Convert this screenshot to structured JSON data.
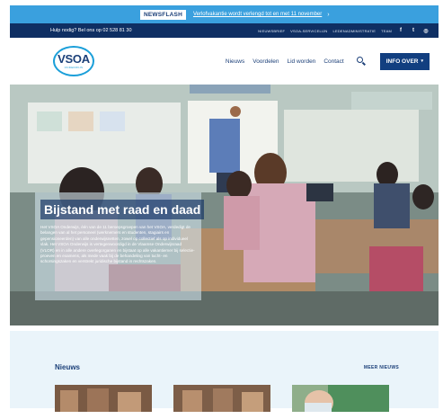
{
  "newsflash": {
    "badge": "NEWSFLASH",
    "text": "Verlofvakantie wordt verlengd tot en met 11 november",
    "arrow": "›"
  },
  "topbar": {
    "help": "Hulp nodig? Bel ons op 02 528 81 30",
    "links": [
      "NIEUWSBRIEF",
      "VSOA-SERVICELIJN",
      "LEDENADMINISTRATIE",
      "TEAM"
    ],
    "social": [
      "f",
      "t",
      "◎"
    ]
  },
  "logo": {
    "text": "VSOA",
    "sub": "ONDERWIJS"
  },
  "nav": {
    "items": [
      "Nieuws",
      "Voordelen",
      "Lid worden",
      "Contact"
    ],
    "info_button": "INFO OVER",
    "info_chevron": "▾"
  },
  "hero": {
    "title": "Bijstand met raad en daad",
    "body": "Het VSOA Onderwijs, één van de 11 beroepsgroepen van het VSOA, verdedigt de belangen van al het personeel (werknemers en studenten, stagiairs en gepensioneerden) van alle onderwijsnetten, zowel op collectief als op individueel vlak. Het VSOA Onderwijs is vertegenwoordigd in de Vlaamse Onderwijsraad (VLOR) en in alle andere overlegorganen en bijstaat op alle vakantiemer bij selectie-proeven en examens, als mede vaak bij de behandeling van tucht- en schorsingszaken en verstrekt juridische bijstand in rechtszaken."
  },
  "news": {
    "title": "Nieuws",
    "more": "MEER NIEUWS"
  },
  "colors": {
    "navy": "#0f2f63",
    "blue": "#3aa0de",
    "brand": "#1b3f78",
    "news_bg": "#eaf4fa"
  }
}
